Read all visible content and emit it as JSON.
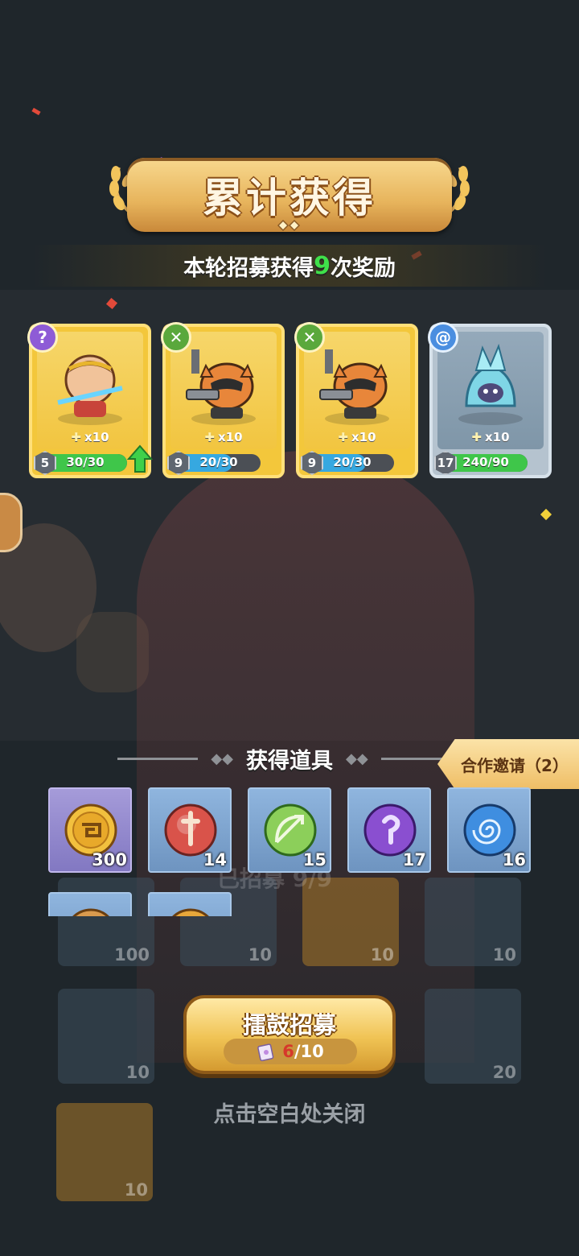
{
  "banner": {
    "title": "累计获得"
  },
  "subtitle": {
    "prefix": "本轮招募获得",
    "count": "9",
    "suffix": "次奖励"
  },
  "hero_cards": [
    {
      "name_icon": "warrior-hero-icon",
      "class_icon": "hook-class-icon",
      "shards": "x10",
      "level": "5",
      "progress": "30/30",
      "fill": 1.0,
      "rarity": "gold",
      "upgrade": true
    },
    {
      "name_icon": "raccoon-gunner-icon",
      "class_icon": "bow-class-icon",
      "shards": "x10",
      "level": "9",
      "progress": "20/30",
      "fill": 0.6667,
      "rarity": "gold",
      "upgrade": false
    },
    {
      "name_icon": "raccoon-gunner-icon",
      "class_icon": "bow-class-icon",
      "shards": "x10",
      "level": "9",
      "progress": "20/30",
      "fill": 0.6667,
      "rarity": "gold",
      "upgrade": false
    },
    {
      "name_icon": "ice-spirit-icon",
      "class_icon": "spiral-class-icon",
      "shards": "x10",
      "level": "17",
      "progress": "240/90",
      "fill": 1.0,
      "rarity": "blue",
      "upgrade": false
    }
  ],
  "items_section": {
    "title": "获得道具",
    "coop_button": "合作邀请（2）",
    "items": [
      {
        "icon": "coin-icon",
        "count": "300",
        "bg": "purple"
      },
      {
        "icon": "sword-orb-icon",
        "count": "14",
        "bg": "blue"
      },
      {
        "icon": "bow-orb-icon",
        "count": "15",
        "bg": "blue"
      },
      {
        "icon": "hook-orb-icon",
        "count": "17",
        "bg": "blue"
      },
      {
        "icon": "spiral-orb-icon",
        "count": "16",
        "bg": "blue"
      },
      {
        "icon": "wing-orb-icon",
        "count": "",
        "bg": "blue"
      },
      {
        "icon": "gold-coin-icon",
        "count": "",
        "bg": "blue"
      }
    ]
  },
  "background_grid": {
    "counts": [
      "100",
      "10",
      "10",
      "10",
      "10",
      "20",
      "10"
    ],
    "faded_text": "已招募 9/9"
  },
  "recruit_button": {
    "label": "擂鼓招募",
    "used": "6",
    "total": "/10"
  },
  "close_hint": "点击空白处关闭",
  "colors": {
    "gold_card": "#f3c73b",
    "blue_card": "#b5c3cf",
    "progress_full": "#3fc64a",
    "progress_partial": "#36a8e0",
    "highlight_green": "#3fe04a"
  }
}
